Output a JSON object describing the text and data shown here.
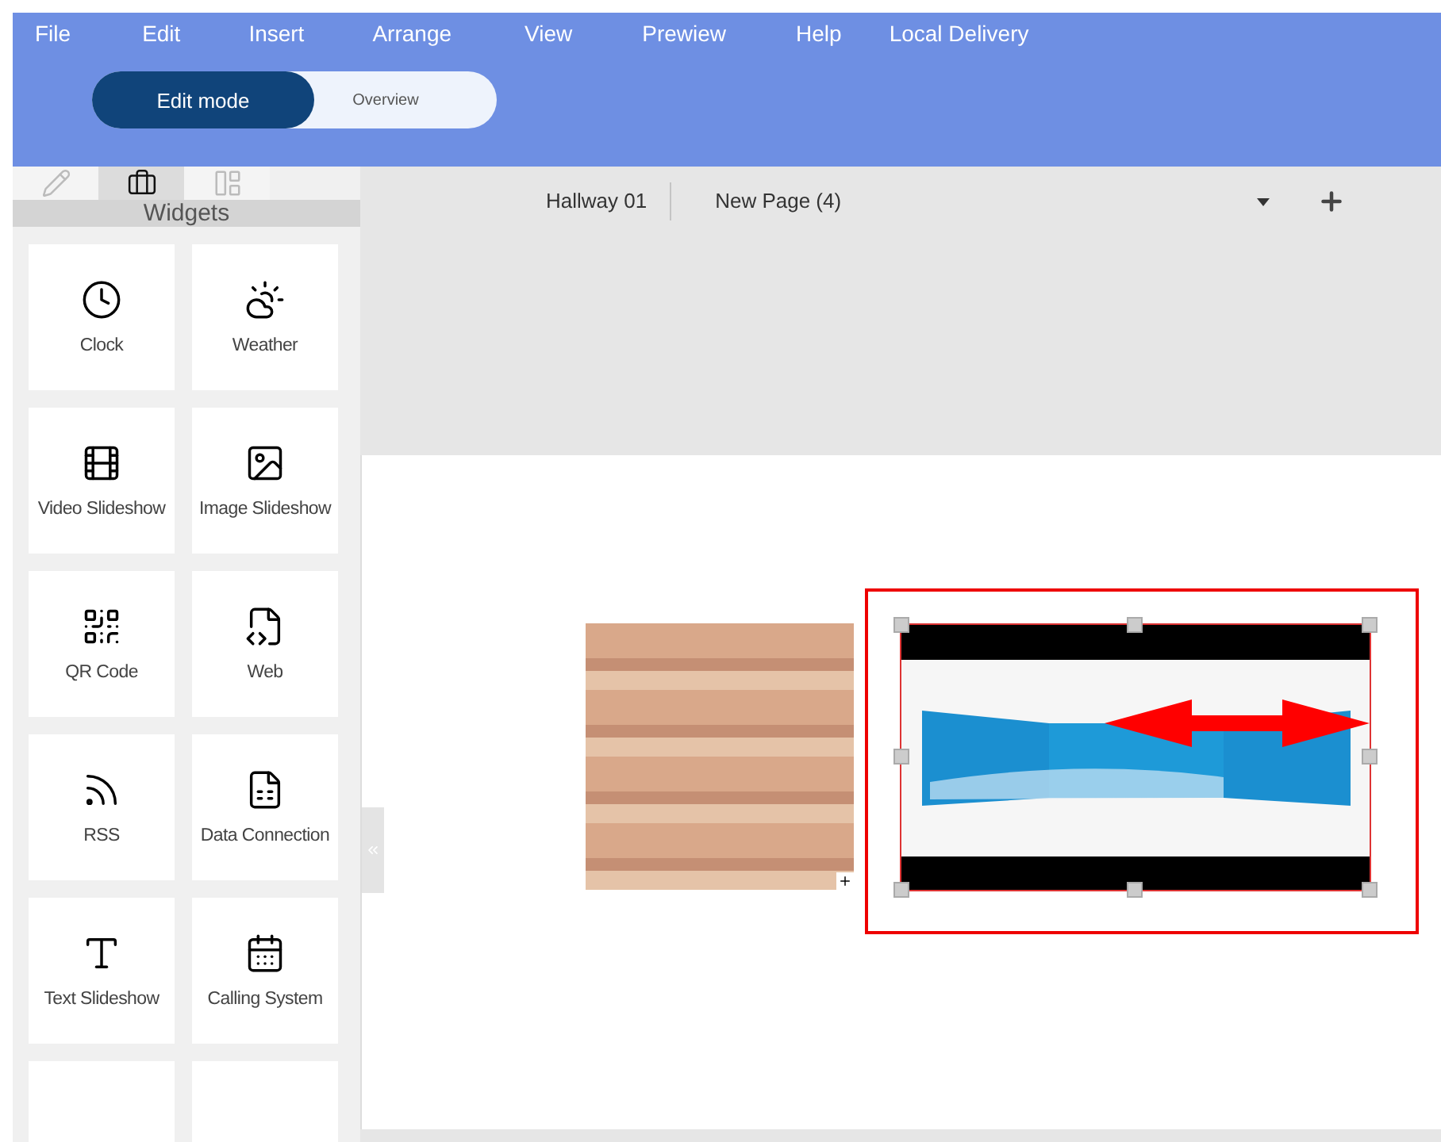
{
  "menu": [
    "File",
    "Edit",
    "Insert",
    "Arrange",
    "View",
    "Prewiew",
    "Help",
    "Local Delivery"
  ],
  "mode_toggle": [
    {
      "label": "Edit mode",
      "selected": true
    },
    {
      "label": "Overview",
      "selected": false
    }
  ],
  "sidebar": {
    "tabs": [
      {
        "kind": "pencil",
        "selected": false
      },
      {
        "kind": "briefcase",
        "selected": true
      },
      {
        "kind": "layout",
        "selected": false
      }
    ],
    "header": "Widgets",
    "widgets": [
      {
        "label": "Clock",
        "kind": "clock"
      },
      {
        "label": "Weather",
        "kind": "weather"
      },
      {
        "label": "Video Slideshow",
        "kind": "video"
      },
      {
        "label": "Image Slideshow",
        "kind": "image"
      },
      {
        "label": "QR Code",
        "kind": "qr"
      },
      {
        "label": "Web",
        "kind": "web"
      },
      {
        "label": "RSS",
        "kind": "rss"
      },
      {
        "label": "Data Connection",
        "kind": "data"
      },
      {
        "label": "Text Slideshow",
        "kind": "text"
      },
      {
        "label": "Calling System",
        "kind": "calling"
      }
    ]
  },
  "page_tabs": [
    "Hallway 01",
    "New Page (4)"
  ],
  "canvas": {
    "items": [
      {
        "kind": "photo",
        "selected": false
      },
      {
        "kind": "video-wall",
        "selected": true
      }
    ]
  }
}
